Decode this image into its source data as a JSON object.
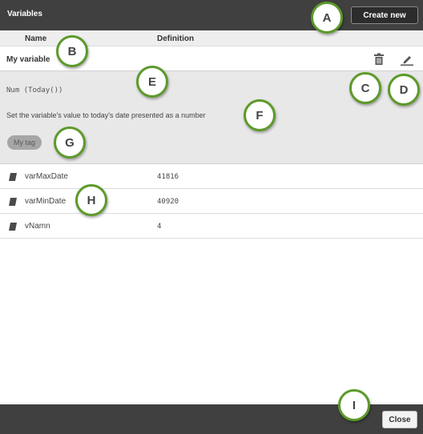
{
  "header": {
    "title": "Variables",
    "create_label": "Create new"
  },
  "columns": {
    "name": "Name",
    "definition": "Definition"
  },
  "selected": {
    "name": "My variable",
    "definition": "Num (Today())",
    "description": "Set the variable's value to today's date presented as a number",
    "tag": "My tag"
  },
  "variables": [
    {
      "name": "varMaxDate",
      "value": "41816",
      "icon": "variable-icon"
    },
    {
      "name": "varMinDate",
      "value": "40920",
      "icon": "variable-icon"
    },
    {
      "name": "vNamn",
      "value": "4",
      "icon": "variable-icon"
    }
  ],
  "footer": {
    "close_label": "Close"
  },
  "callouts": [
    "A",
    "B",
    "C",
    "D",
    "E",
    "F",
    "G",
    "H",
    "I"
  ],
  "colors": {
    "header_bg": "#404040",
    "detail_bg": "#e8e8e8",
    "callout_ring": "#5c9a2a",
    "tag_bg": "#a6a6a6"
  }
}
